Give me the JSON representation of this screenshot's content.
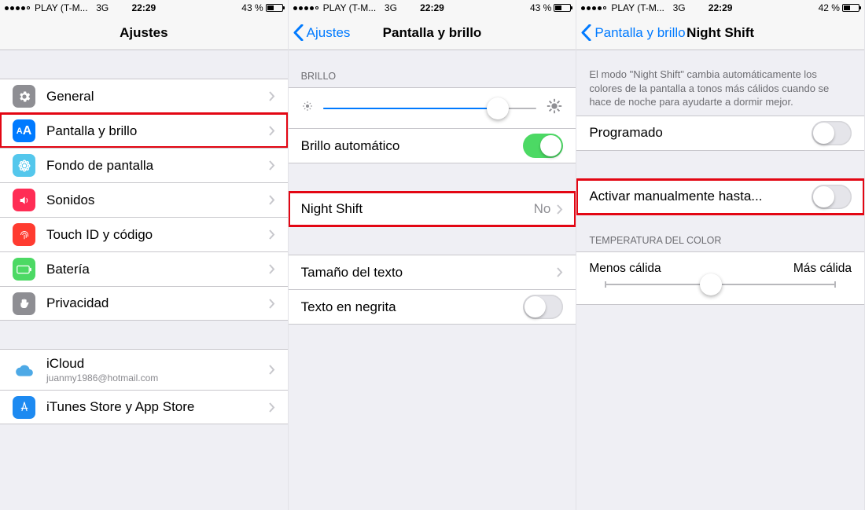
{
  "status": {
    "carrier": "PLAY (T-M...",
    "network": "3G",
    "time": "22:29",
    "battery_pct_a": "43 %",
    "battery_pct_c": "42 %"
  },
  "screen1": {
    "title": "Ajustes",
    "rows": {
      "general": "General",
      "display": "Pantalla y brillo",
      "wallpaper": "Fondo de pantalla",
      "sounds": "Sonidos",
      "touchid": "Touch ID y código",
      "battery": "Batería",
      "privacy": "Privacidad",
      "icloud": "iCloud",
      "icloud_sub": "juanmy1986@hotmail.com",
      "itunes": "iTunes Store y App Store"
    }
  },
  "screen2": {
    "back": "Ajustes",
    "title": "Pantalla y brillo",
    "section_brightness": "BRILLO",
    "auto_brightness": "Brillo automático",
    "night_shift": "Night Shift",
    "night_shift_value": "No",
    "text_size": "Tamaño del texto",
    "bold_text": "Texto en negrita",
    "brightness_pct": 82
  },
  "screen3": {
    "back": "Pantalla y brillo",
    "title": "Night Shift",
    "note": "El modo \"Night Shift\" cambia automáticamente los colores de la pantalla a tonos más cálidos cuando se hace de noche para ayudarte a dormir mejor.",
    "scheduled": "Programado",
    "manual": "Activar manualmente hasta...",
    "temp_header": "TEMPERATURA DEL COLOR",
    "less_warm": "Menos cálida",
    "more_warm": "Más cálida",
    "temp_pct": 46
  }
}
